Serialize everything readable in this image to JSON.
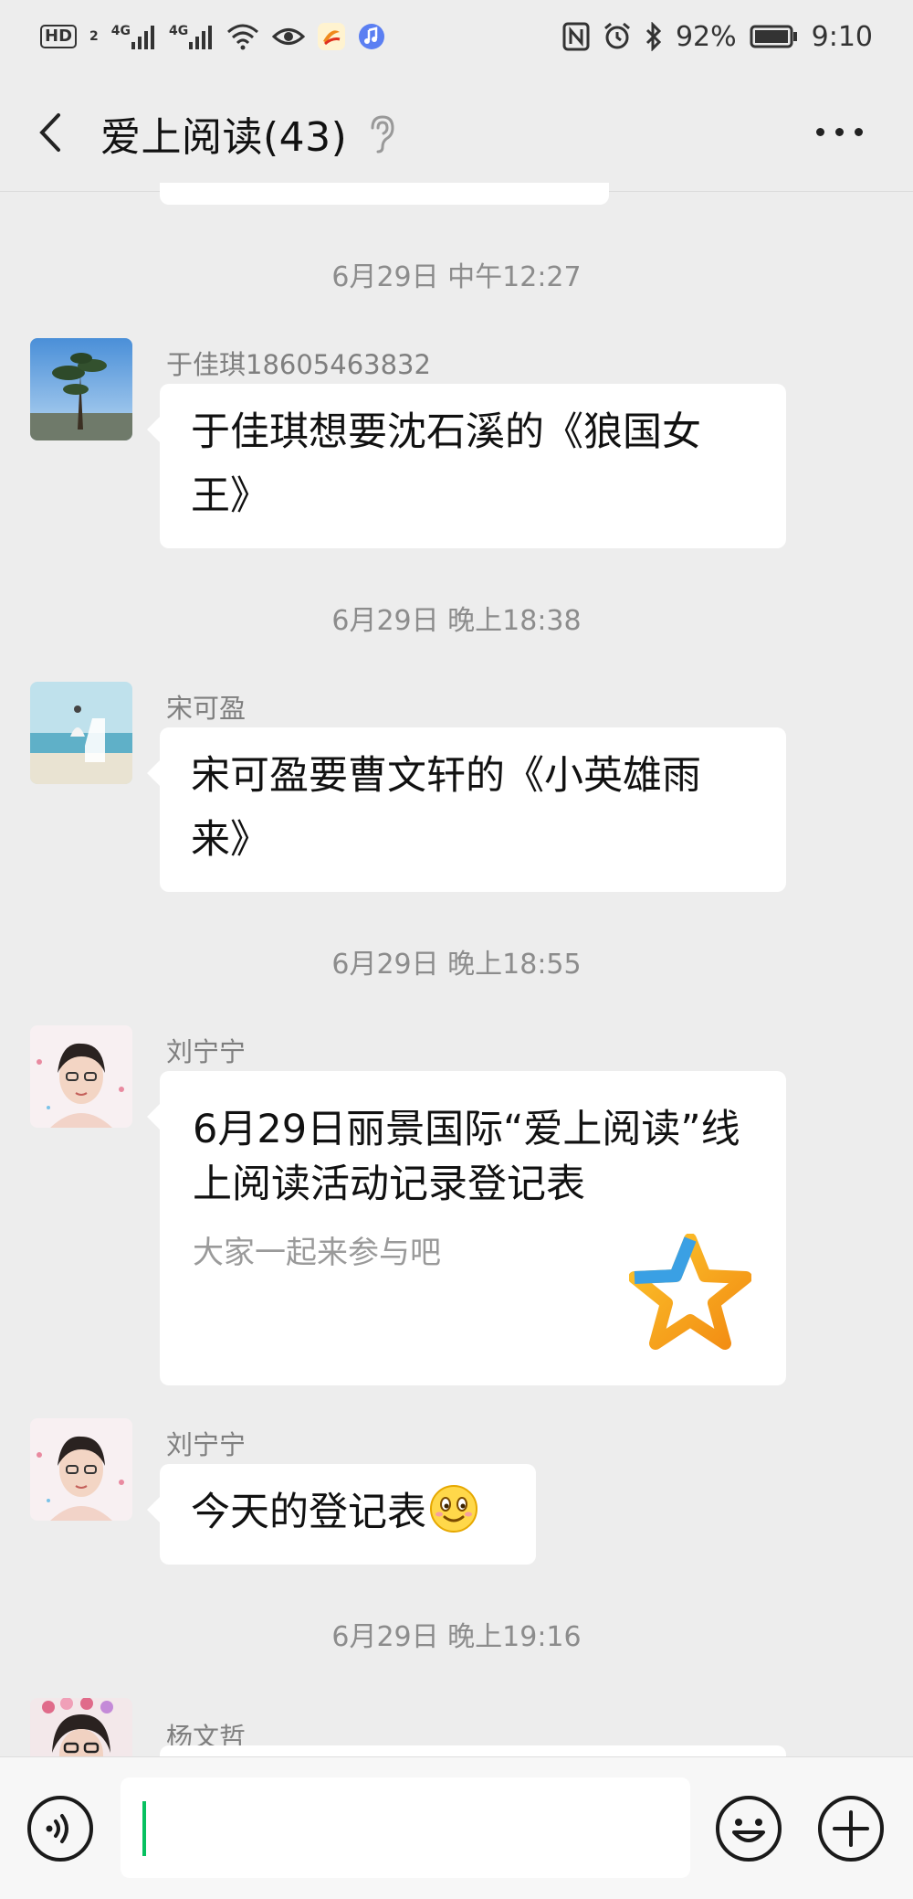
{
  "status_bar": {
    "hd_label": "HD",
    "hd_sub": "2",
    "net1": "4G",
    "net2": "4G",
    "battery": "92%",
    "time": "9:10"
  },
  "header": {
    "title": "爱上阅读(43)"
  },
  "messages": [
    {
      "time": "6月29日 中午12:27",
      "sender": "于佳琪18605463832",
      "text": "于佳琪想要沈石溪的《狼国女王》"
    },
    {
      "time": "6月29日 晚上18:38",
      "sender": "宋可盈",
      "text": "宋可盈要曹文轩的《小英雄雨来》"
    },
    {
      "time": "6月29日 晚上18:55",
      "sender": "刘宁宁",
      "card_title": "6月29日丽景国际“爱上阅读”线上阅读活动记录登记表",
      "card_desc": "大家一起来参与吧"
    },
    {
      "sender": "刘宁宁",
      "text": "今天的登记表"
    },
    {
      "time": "6月29日 晚上19:16",
      "sender": "杨文哲"
    }
  ],
  "input": {
    "value": ""
  },
  "colors": {
    "background": "#ededed",
    "bubble": "#ffffff",
    "caret": "#07c160",
    "timestamp": "#8c8c8c"
  },
  "icons": [
    "back-arrow-icon",
    "ear-icon",
    "more-icon",
    "voice-icon",
    "emoji-icon",
    "plus-icon",
    "star-icon",
    "smile-emoji-icon"
  ]
}
